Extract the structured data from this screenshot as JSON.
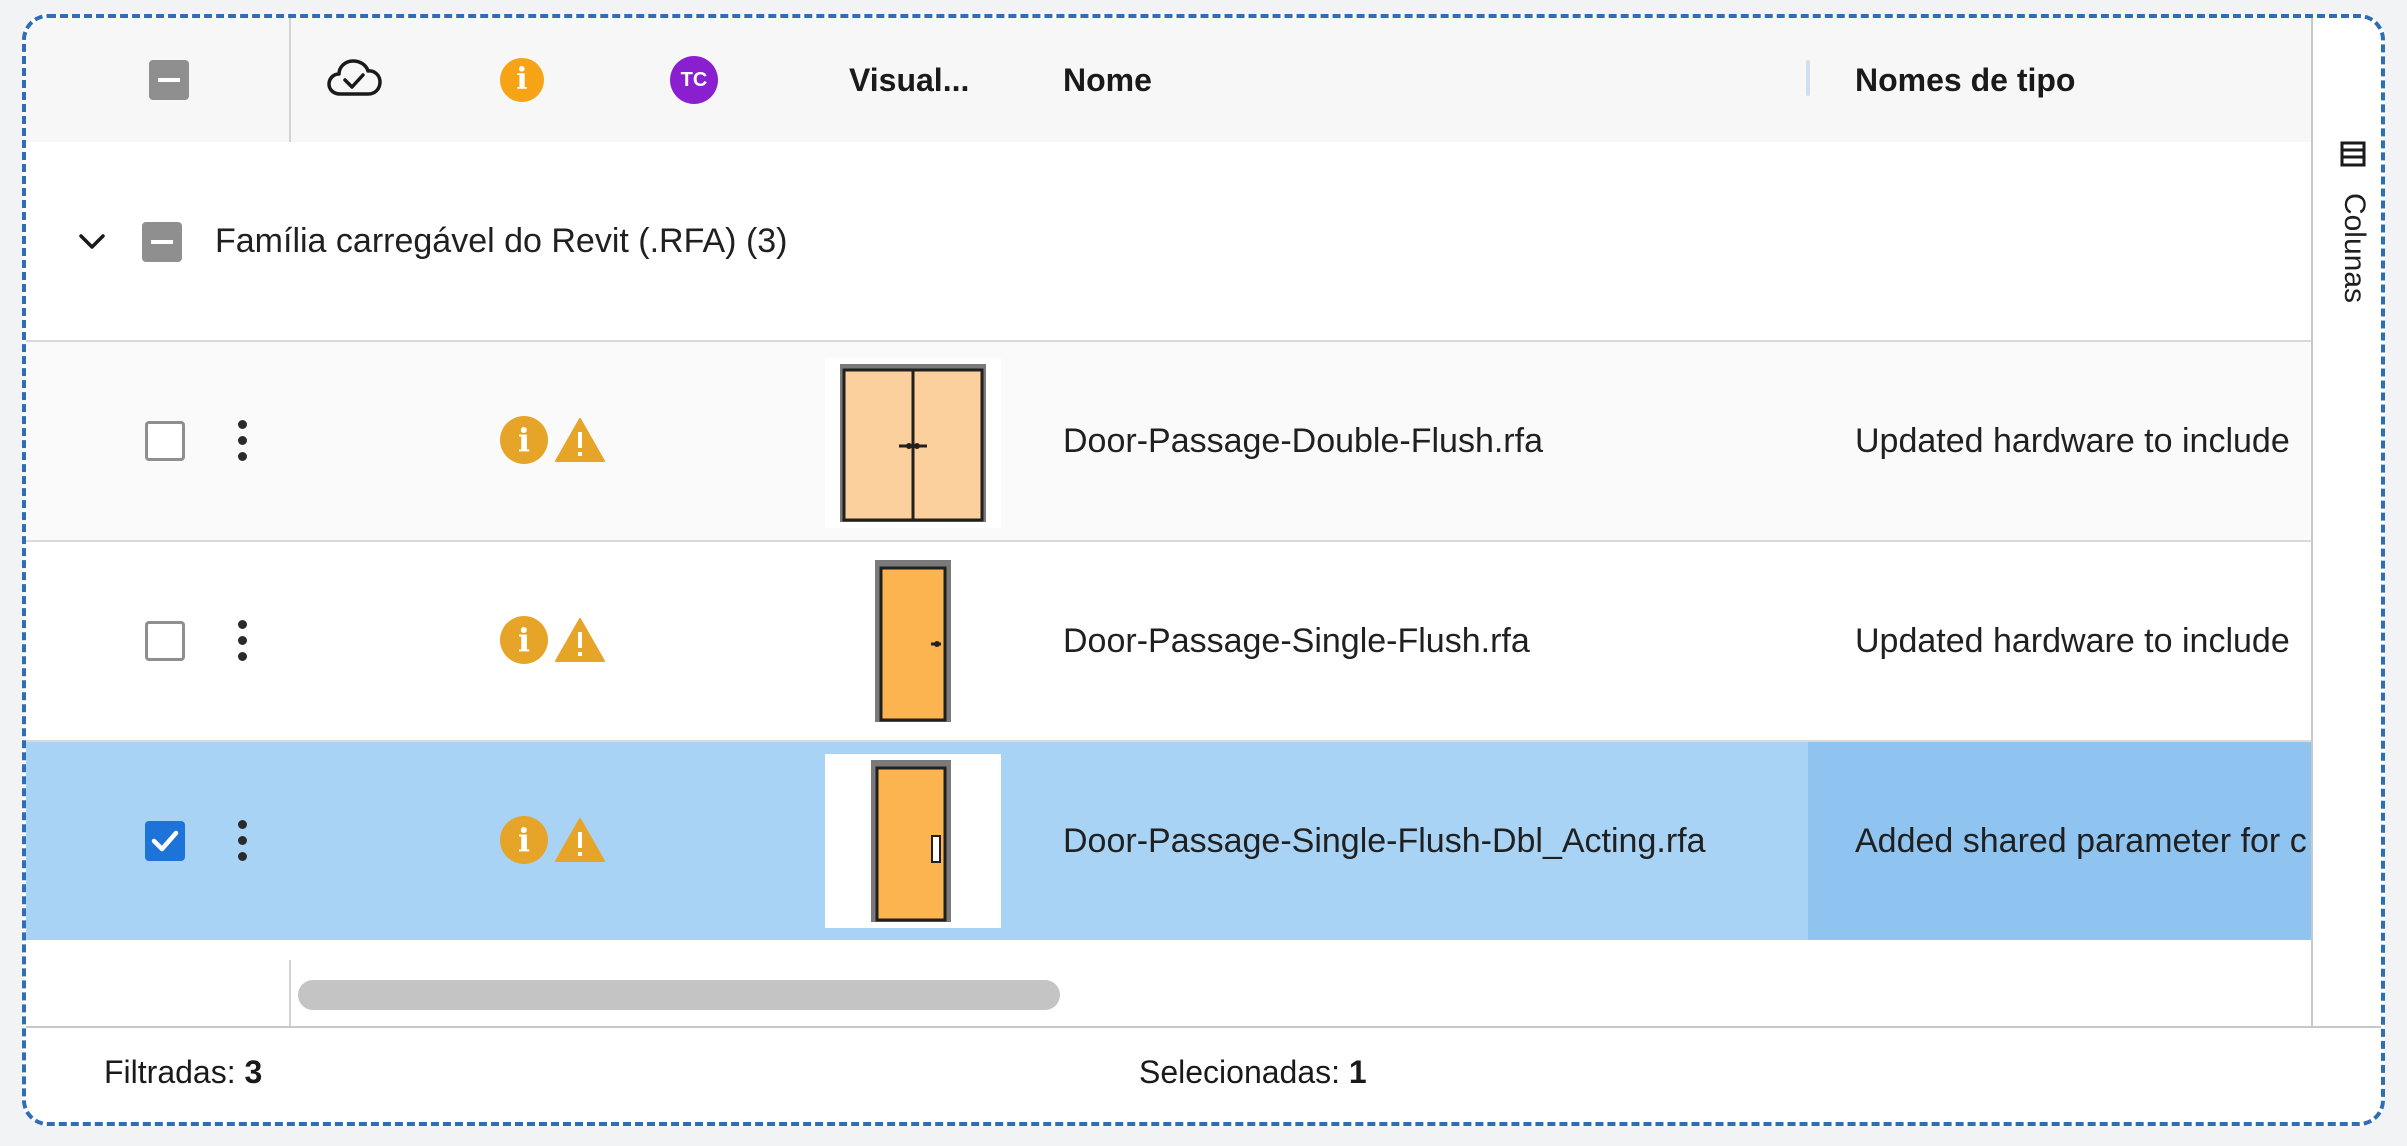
{
  "header": {
    "visual_label": "Visual...",
    "name_label": "Nome",
    "type_names_label": "Nomes de tipo",
    "info_glyph": "i",
    "user_initials": "TC",
    "cloud_icon": "cloud-check-icon"
  },
  "group": {
    "label": "Família carregável do Revit (.RFA)",
    "count": "(3)",
    "expanded": true
  },
  "rows": [
    {
      "name": "Door-Passage-Double-Flush.rfa",
      "type_names": "Updated hardware to include",
      "selected": false,
      "thumbnail": "double-door"
    },
    {
      "name": "Door-Passage-Single-Flush.rfa",
      "type_names": "Updated hardware to include",
      "selected": false,
      "thumbnail": "single-door"
    },
    {
      "name": "Door-Passage-Single-Flush-Dbl_Acting.rfa",
      "type_names": "Added shared parameter for c",
      "selected": true,
      "thumbnail": "single-door-dbl-acting"
    }
  ],
  "side_panel": {
    "columns_label": "Colunas"
  },
  "footer": {
    "filtered_label": "Filtradas:",
    "filtered_count": "3",
    "selected_label": "Selecionadas:",
    "selected_count": "1"
  },
  "colors": {
    "selection_row": "#a9d3f5",
    "selection_cell": "#8fc4f1",
    "accent": "#1e73d8",
    "warning": "#e6a428",
    "avatar": "#8a1fd0"
  }
}
